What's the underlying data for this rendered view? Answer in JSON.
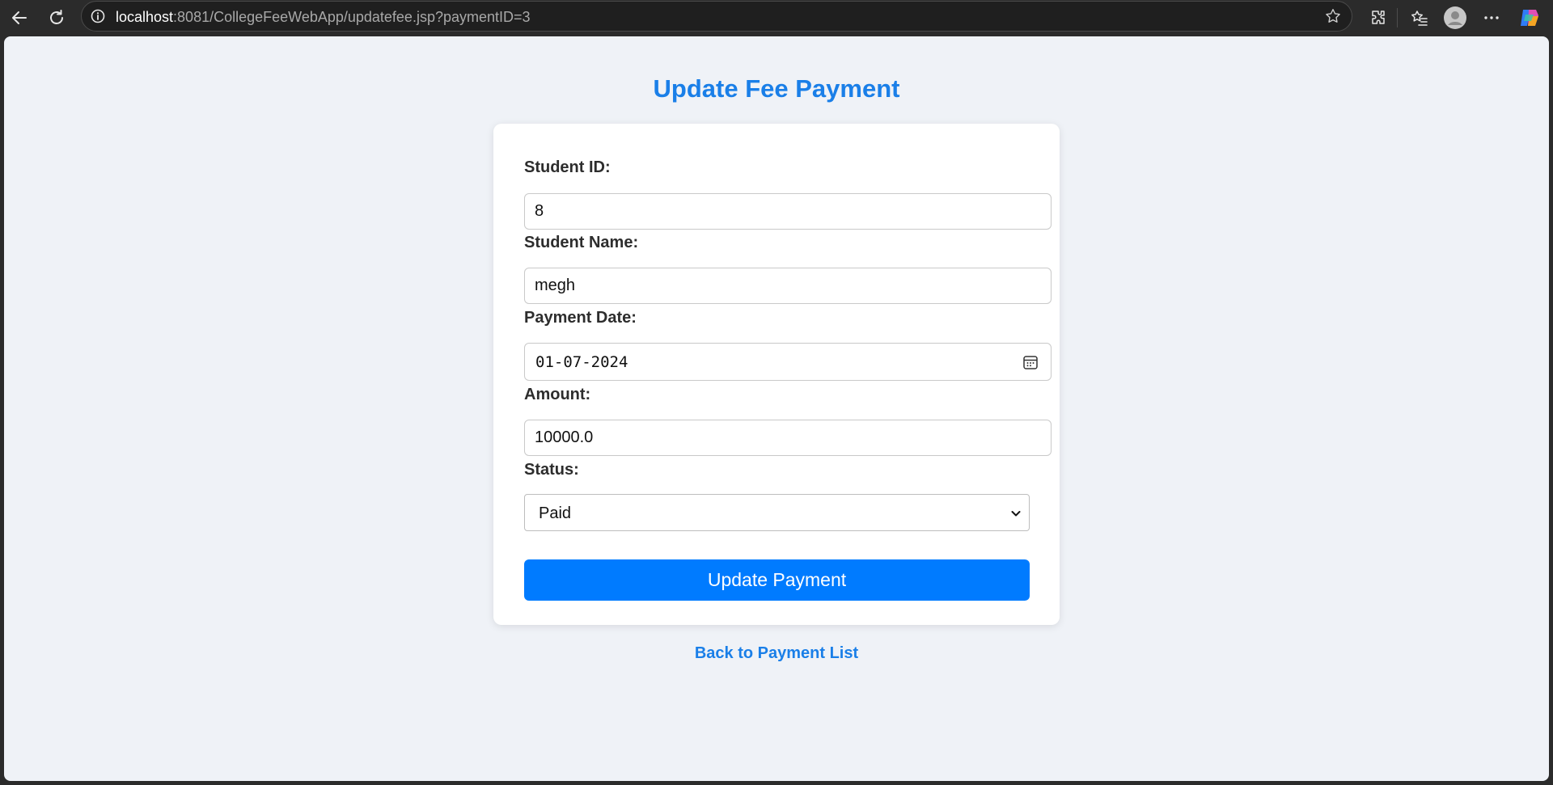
{
  "browser": {
    "url_host": "localhost",
    "url_rest": ":8081/CollegeFeeWebApp/updatefee.jsp?paymentID=3",
    "icons": [
      "back-arrow-icon",
      "reload-icon",
      "site-info-icon",
      "favorite-star-icon",
      "extensions-icon",
      "favorites-icon",
      "profile-avatar-icon",
      "more-options-icon",
      "copilot-icon"
    ]
  },
  "page": {
    "title": "Update Fee Payment",
    "back_link": "Back to Payment List"
  },
  "form": {
    "student_id": {
      "label": "Student ID:",
      "value": "8"
    },
    "student_name": {
      "label": "Student Name:",
      "value": "megh"
    },
    "payment_date": {
      "label": "Payment Date:",
      "value": "01-07-2024"
    },
    "amount": {
      "label": "Amount:",
      "value": "10000.0"
    },
    "status": {
      "label": "Status:",
      "selected": "Paid"
    },
    "submit_label": "Update Payment"
  },
  "colors": {
    "accent": "#007bff",
    "title": "#1a7fe8",
    "page_background": "#eff2f7"
  }
}
